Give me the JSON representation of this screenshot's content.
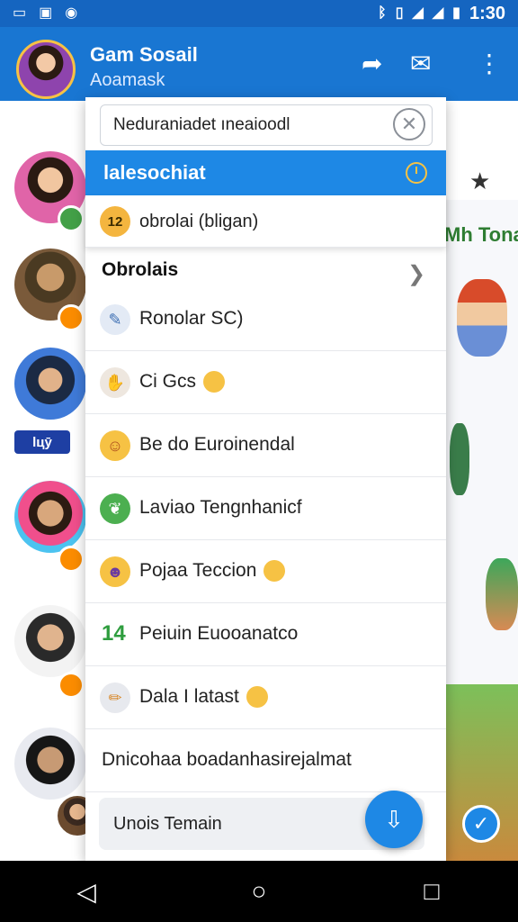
{
  "status_bar": {
    "time": "1:30",
    "icons": [
      "nfc-icon",
      "gallery-icon",
      "circle-icon",
      "bluetooth-icon",
      "vibrate-icon",
      "wifi-icon",
      "signal-icon",
      "battery-icon"
    ]
  },
  "app_bar": {
    "title": "Gam Sosail",
    "subtitle": "Aoamask",
    "icons": [
      "share-icon",
      "mail-icon",
      "more-vert-icon"
    ]
  },
  "dropdown": {
    "search": {
      "value": "Neduraniadet ıneaioodl"
    },
    "selected": {
      "label": "lalesochiat"
    },
    "sub_item": {
      "badge": "12",
      "label": "obrolai (bligan)"
    },
    "section_title": "Obrolais",
    "items": [
      {
        "label": "Ronolar SC)",
        "icon": "pen-icon"
      },
      {
        "label": "Ci Gcs",
        "icon": "hand-icon"
      },
      {
        "label": "Be do Euroinendal",
        "icon": "emoji-icon"
      },
      {
        "label": "Laviao Tengnhanicf",
        "icon": "plant-icon"
      },
      {
        "label": "Pojaa Teccion",
        "icon": "face-icon"
      },
      {
        "label": "Peiuin Euooanatco",
        "num": "14"
      },
      {
        "label": "Dala I latast",
        "icon": "pencil-icon"
      },
      {
        "label": "Dnicohaa boadanhasirejalmat"
      }
    ],
    "bottom_field": {
      "label": "Unois Temain"
    }
  },
  "background": {
    "right_label": "Mh Tona",
    "contact_tag": "lцӯ"
  },
  "colors": {
    "primary": "#1976d2",
    "accent": "#1e88e5",
    "highlight": "#f6c244",
    "green": "#2e9d3e"
  }
}
